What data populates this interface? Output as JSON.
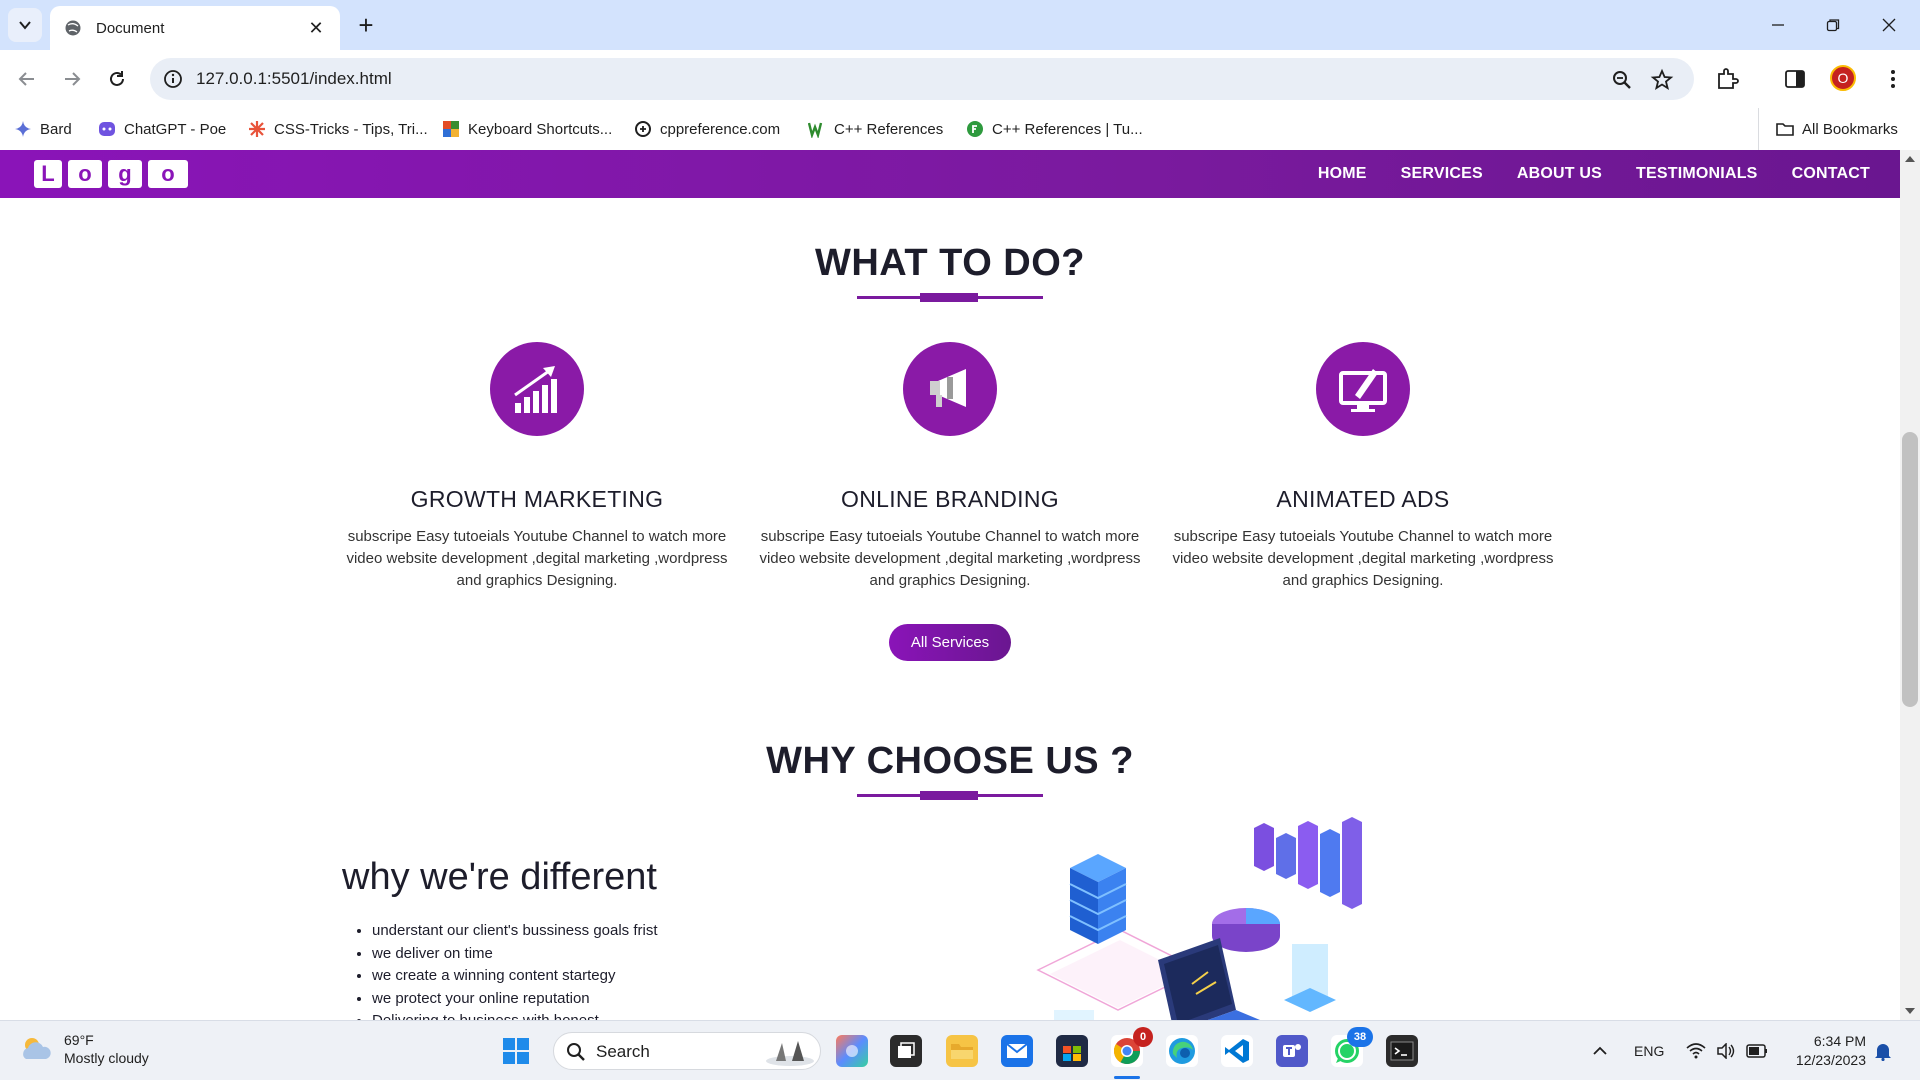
{
  "browser": {
    "tab_title": "Document",
    "url": "127.0.0.1:5501/index.html",
    "profile_initial": "O",
    "bookmarks": [
      {
        "label": "Bard",
        "icon": "sparkle-icon"
      },
      {
        "label": "ChatGPT - Poe",
        "icon": "poe-icon"
      },
      {
        "label": "CSS-Tricks - Tips, Tri...",
        "icon": "star-burst-icon"
      },
      {
        "label": "Keyboard Shortcuts...",
        "icon": "keyboard-icon"
      },
      {
        "label": "cppreference.com",
        "icon": "cpp-icon"
      },
      {
        "label": "C++ References",
        "icon": "w3-icon"
      },
      {
        "label": "C++ References | Tu...",
        "icon": "freecodecamp-icon"
      }
    ],
    "all_bookmarks": "All Bookmarks"
  },
  "site": {
    "logo_letters": [
      "L",
      "o",
      "g",
      "o"
    ],
    "nav": [
      "HOME",
      "SERVICES",
      "ABOUT US",
      "TESTIMONIALS",
      "CONTACT"
    ],
    "what_title": "WHAT TO DO?",
    "services": [
      {
        "title": "GROWTH MARKETING",
        "icon": "growth-chart-icon",
        "text": "subscripe Easy tutoeials Youtube Channel to watch more video website development ,degital marketing ,wordpress and graphics Designing."
      },
      {
        "title": "ONLINE BRANDING",
        "icon": "megaphone-icon",
        "text": "subscripe Easy tutoeials Youtube Channel to watch more video website development ,degital marketing ,wordpress and graphics Designing."
      },
      {
        "title": "ANIMATED ADS",
        "icon": "monitor-edit-icon",
        "text": "subscripe Easy tutoeials Youtube Channel to watch more video website development ,degital marketing ,wordpress and graphics Designing."
      }
    ],
    "all_services_label": "All Services",
    "why_title": "WHY CHOOSE US ?",
    "diff_title": "why we're different",
    "diff_items": [
      "understant our client's bussiness goals frist",
      "we deliver on time",
      "we create a winning content startegy",
      "we protect your online reputation",
      "Delivering to business with honest"
    ],
    "accent_color": "#8a1aa7"
  },
  "taskbar": {
    "weather_temp": "69°F",
    "weather_desc": "Mostly cloudy",
    "search_label": "Search",
    "chrome_badge": "0",
    "whatsapp_badge": "38",
    "lang": "ENG",
    "time": "6:34 PM",
    "date": "12/23/2023"
  }
}
